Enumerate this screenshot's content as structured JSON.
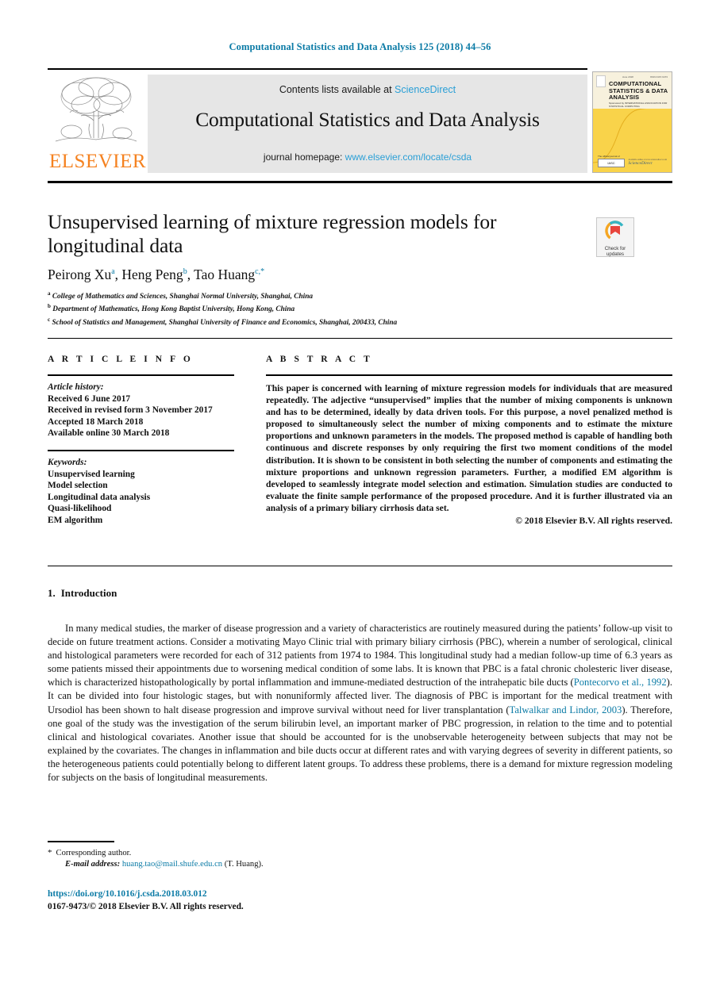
{
  "running_head": "Computational Statistics and Data Analysis 125 (2018) 44–56",
  "masthead": {
    "contents_prefix": "Contents lists available at ",
    "sciencedirect": "ScienceDirect",
    "journal_title": "Computational Statistics and Data Analysis",
    "homepage_prefix": "journal homepage: ",
    "homepage_url": "www.elsevier.com/locate/csda",
    "publisher": "ELSEVIER",
    "cover": {
      "title": "COMPUTATIONAL STATISTICS & DATA ANALYSIS",
      "subtitle": "Sponsored by INTERNATIONAL ASSOCIATION FOR STATISTICAL COMPUTING",
      "top_left": "Vol. 125",
      "top_mid": "June 2018",
      "top_right": "ISSN 0167-9473",
      "badge": "IASC",
      "badge_label": "The official journal of",
      "sciencedirect": "ScienceDirect",
      "sciencedirect_sup": "Available online at www.sciencedirect.com"
    },
    "link_color": "#2a9fd6",
    "elsevier_orange": "#F58220"
  },
  "article": {
    "title": "Unsupervised learning of mixture regression models for longitudinal data",
    "authors": [
      {
        "name": "Peirong Xu",
        "marker": "a"
      },
      {
        "name": "Heng Peng",
        "marker": "b"
      },
      {
        "name": "Tao Huang",
        "marker": "c,*"
      }
    ],
    "affiliations": [
      {
        "marker": "a",
        "text": "College of Mathematics and Sciences, Shanghai Normal University, Shanghai, China"
      },
      {
        "marker": "b",
        "text": "Department of Mathematics, Hong Kong Baptist University, Hong Kong, China"
      },
      {
        "marker": "c",
        "text": "School of Statistics and Management, Shanghai University of Finance and Economics, Shanghai, 200433, China"
      }
    ],
    "crossmark": "Check for updates"
  },
  "article_info": {
    "heading": "A R T I C L E   I N F O",
    "history_label": "Article history:",
    "history": [
      "Received 6 June 2017",
      "Received in revised form 3 November 2017",
      "Accepted 18 March 2018",
      "Available online 30 March 2018"
    ],
    "keywords_label": "Keywords:",
    "keywords": [
      "Unsupervised learning",
      "Model selection",
      "Longitudinal data analysis",
      "Quasi-likelihood",
      "EM algorithm"
    ]
  },
  "abstract": {
    "heading": "A B S T R A C T",
    "text": "This paper is concerned with learning of mixture regression models for individuals that are measured repeatedly. The adjective “unsupervised” implies that the number of mixing components is unknown and has to be determined, ideally by data driven tools. For this purpose, a novel penalized method is proposed to simultaneously select the number of mixing components and to estimate the mixture proportions and unknown parameters in the models. The proposed method is capable of handling both continuous and discrete responses by only requiring the first two moment conditions of the model distribution. It is shown to be consistent in both selecting the number of components and estimating the mixture proportions and unknown regression parameters. Further, a modified EM algorithm is developed to seamlessly integrate model selection and estimation. Simulation studies are conducted to evaluate the finite sample performance of the proposed procedure. And it is further illustrated via an analysis of a primary biliary cirrhosis data set.",
    "copyright": "© 2018 Elsevier B.V. All rights reserved."
  },
  "sections": {
    "intro_number": "1.",
    "intro_title": "Introduction",
    "intro_p1_a": "In many medical studies, the marker of disease progression and a variety of characteristics are routinely measured during the patients’ follow-up visit to decide on future treatment actions. Consider a motivating Mayo Clinic trial with primary biliary cirrhosis (PBC), wherein a number of serological, clinical and histological parameters were recorded for each of 312 patients from 1974 to 1984. This longitudinal study had a median follow-up time of 6.3 years as some patients missed their appointments due to worsening medical condition of some labs. It is known that PBC is a fatal chronic cholesteric liver disease, which is characterized histopathologically by portal inflammation and immune-mediated destruction of the intrahepatic bile ducts (",
    "cite1": "Pontecorvo et al., 1992",
    "intro_p1_b": "). It can be divided into four histologic stages, but with nonuniformly affected liver. The diagnosis of PBC is important for the medical treatment with Ursodiol has been shown to halt disease progression and improve survival without need for liver transplantation (",
    "cite2": "Talwalkar and Lindor, 2003",
    "intro_p1_c": "). Therefore, one goal of the study was the investigation of the serum bilirubin level, an important marker of PBC progression, in relation to the time and to potential clinical and histological covariates. Another issue that should be accounted for is the unobservable heterogeneity between subjects that may not be explained by the covariates. The changes in inflammation and bile ducts occur at different rates and with varying degrees of severity in different patients, so the heterogeneous patients could potentially belong to different latent groups. To address these problems, there is a demand for mixture regression modeling for subjects on the basis of longitudinal measurements."
  },
  "footer": {
    "corresponding": "Corresponding author.",
    "email_label": "E-mail address:",
    "email": "huang.tao@mail.shufe.edu.cn",
    "email_suffix": "(T. Huang).",
    "doi": "https://doi.org/10.1016/j.csda.2018.03.012",
    "issn": "0167-9473/© 2018 Elsevier B.V. All rights reserved."
  }
}
